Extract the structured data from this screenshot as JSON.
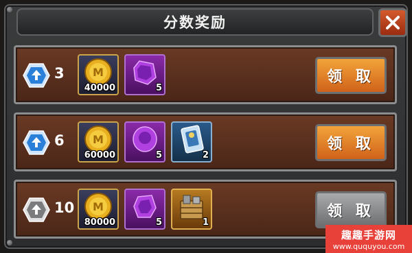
{
  "dialog": {
    "title": "分数奖励",
    "close_icon": "close-x-icon"
  },
  "colors": {
    "claim_active": "#e8822a",
    "claim_disabled": "#8a8c8e",
    "close_red": "#c0441e",
    "row_brown": "#5a2e1c"
  },
  "rows": [
    {
      "score": "3",
      "tier_icon": "blue-hexagon-rank-icon",
      "items": [
        {
          "icon": "gold-coin-icon",
          "qty": "40000"
        },
        {
          "icon": "purple-gem-icon",
          "qty": "5"
        }
      ],
      "claim_label": "领 取",
      "claim_state": "active"
    },
    {
      "score": "6",
      "tier_icon": "blue-hexagon-rank-icon",
      "items": [
        {
          "icon": "gold-coin-icon",
          "qty": "60000"
        },
        {
          "icon": "purple-gem-icon",
          "qty": "5"
        },
        {
          "icon": "blue-card-icon",
          "qty": "2"
        }
      ],
      "claim_label": "领 取",
      "claim_state": "active"
    },
    {
      "score": "10",
      "tier_icon": "silver-hexagon-rank-icon",
      "items": [
        {
          "icon": "gold-coin-icon",
          "qty": "80000"
        },
        {
          "icon": "purple-gem-icon",
          "qty": "5"
        },
        {
          "icon": "supply-pack-icon",
          "qty": "1"
        }
      ],
      "claim_label": "领 取",
      "claim_state": "disabled"
    }
  ],
  "watermark": {
    "title": "趣趣手游网",
    "url": "www.ququyou.com"
  }
}
